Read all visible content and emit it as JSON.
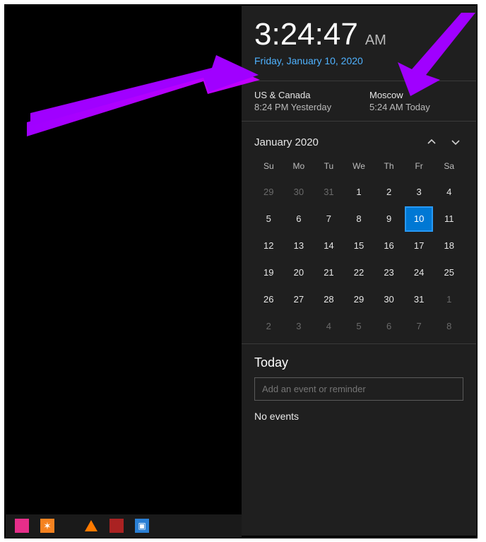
{
  "clock": {
    "time": "3:24:47",
    "ampm": "AM",
    "date": "Friday, January 10, 2020"
  },
  "world_clocks": [
    {
      "name": "US & Canada",
      "time": "8:24 PM Yesterday"
    },
    {
      "name": "Moscow",
      "time": "5:24 AM Today"
    }
  ],
  "calendar": {
    "month_label": "January 2020",
    "dow": [
      "Su",
      "Mo",
      "Tu",
      "We",
      "Th",
      "Fr",
      "Sa"
    ],
    "days": [
      {
        "n": "29",
        "other": true
      },
      {
        "n": "30",
        "other": true
      },
      {
        "n": "31",
        "other": true
      },
      {
        "n": "1"
      },
      {
        "n": "2"
      },
      {
        "n": "3"
      },
      {
        "n": "4"
      },
      {
        "n": "5"
      },
      {
        "n": "6"
      },
      {
        "n": "7"
      },
      {
        "n": "8"
      },
      {
        "n": "9"
      },
      {
        "n": "10",
        "today": true
      },
      {
        "n": "11"
      },
      {
        "n": "12"
      },
      {
        "n": "13"
      },
      {
        "n": "14"
      },
      {
        "n": "15"
      },
      {
        "n": "16"
      },
      {
        "n": "17"
      },
      {
        "n": "18"
      },
      {
        "n": "19"
      },
      {
        "n": "20"
      },
      {
        "n": "21"
      },
      {
        "n": "22"
      },
      {
        "n": "23"
      },
      {
        "n": "24"
      },
      {
        "n": "25"
      },
      {
        "n": "26"
      },
      {
        "n": "27"
      },
      {
        "n": "28"
      },
      {
        "n": "29"
      },
      {
        "n": "30"
      },
      {
        "n": "31"
      },
      {
        "n": "1",
        "other": true
      },
      {
        "n": "2",
        "other": true
      },
      {
        "n": "3",
        "other": true
      },
      {
        "n": "4",
        "other": true
      },
      {
        "n": "5",
        "other": true
      },
      {
        "n": "6",
        "other": true
      },
      {
        "n": "7",
        "other": true
      },
      {
        "n": "8",
        "other": true
      }
    ]
  },
  "agenda": {
    "title": "Today",
    "input_placeholder": "Add an event or reminder",
    "empty": "No events"
  }
}
